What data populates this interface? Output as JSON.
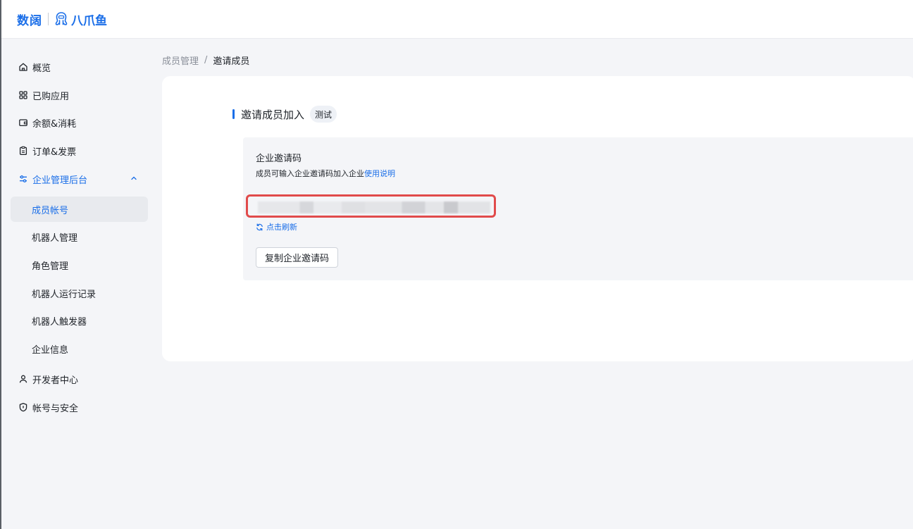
{
  "header": {
    "logo_primary": "数阔",
    "logo_secondary": "八爪鱼"
  },
  "sidebar": {
    "items": [
      {
        "label": "概览",
        "icon": "home-icon"
      },
      {
        "label": "已购应用",
        "icon": "apps-grid-icon"
      },
      {
        "label": "余额&消耗",
        "icon": "wallet-icon"
      },
      {
        "label": "订单&发票",
        "icon": "clipboard-icon"
      },
      {
        "label": "企业管理后台",
        "icon": "sliders-icon",
        "expanded": true
      },
      {
        "label": "开发者中心",
        "icon": "user-icon"
      },
      {
        "label": "帐号与安全",
        "icon": "shield-icon"
      }
    ],
    "sub_items": [
      {
        "label": "成员帐号",
        "selected": true
      },
      {
        "label": "机器人管理"
      },
      {
        "label": "角色管理"
      },
      {
        "label": "机器人运行记录"
      },
      {
        "label": "机器人触发器"
      },
      {
        "label": "企业信息"
      }
    ]
  },
  "breadcrumb": {
    "parent": "成员管理",
    "separator": "/",
    "current": "邀请成员"
  },
  "main": {
    "title": "邀请成员加入",
    "tag": "测试",
    "panel": {
      "title": "企业邀请码",
      "description": "成员可输入企业邀请码加入企业",
      "help_link": "使用说明",
      "refresh_label": "点击刷新",
      "copy_button": "复制企业邀请码"
    }
  },
  "colors": {
    "accent": "#1a6ee8",
    "highlight_border": "#e14b4b",
    "background": "#f4f5f8"
  }
}
